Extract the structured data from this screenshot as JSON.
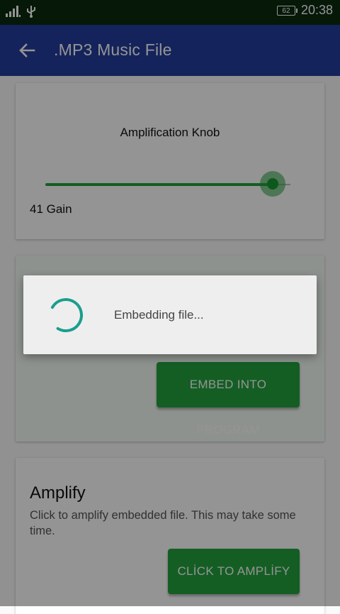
{
  "status_bar": {
    "battery": "62",
    "time": "20:38"
  },
  "app_bar": {
    "title": ".MP3 Music File"
  },
  "amplification": {
    "label": "Amplification Knob",
    "gain_text": "41 Gain",
    "level_fraction": 0.93
  },
  "embed": {
    "button_label": "EMBED INTO PROGRAM"
  },
  "amplify": {
    "title": "Amplify",
    "description": "Click to amplify embedded file. This may take some time.",
    "button_label": "CLİCK TO AMPLİFY"
  },
  "dialog": {
    "message": "Embedding file..."
  },
  "colors": {
    "app_bar": "#233d9d",
    "status_bar": "#0c2a0f",
    "accent_green": "#23a33e",
    "spinner": "#1a9e8c"
  }
}
